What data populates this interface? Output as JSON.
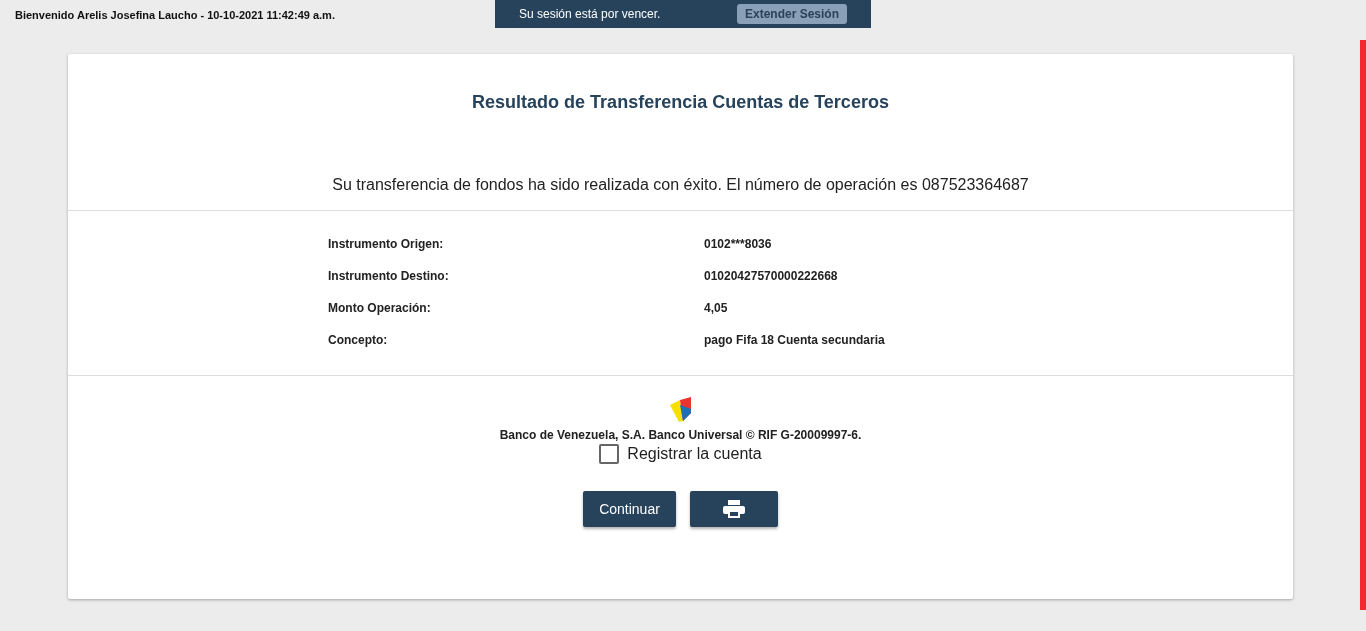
{
  "header": {
    "welcome": "Bienvenido Arelis Josefina Laucho - 10-10-2021 11:42:49 a.m."
  },
  "session_toast": {
    "message": "Su sesión está por vencer.",
    "button": "Extender Sesión"
  },
  "title": "Resultado de Transferencia Cuentas de Terceros",
  "message": "Su transferencia de fondos ha sido realizada con éxito. El número de operación es 087523364687",
  "details": [
    {
      "label": "Instrumento Origen:",
      "value": "0102***8036"
    },
    {
      "label": "Instrumento Destino:",
      "value": "01020427570000222668"
    },
    {
      "label": "Monto Operación:",
      "value": "4,05"
    },
    {
      "label": "Concepto:",
      "value": "pago Fifa 18 Cuenta secundaria"
    }
  ],
  "footer": {
    "legal": "Banco de Venezuela, S.A. Banco Universal © RIF G-20009997-6."
  },
  "register_checkbox": {
    "label": "Registrar la cuenta",
    "checked": false
  },
  "buttons": [
    {
      "kind": "text",
      "label": "Continuar"
    },
    {
      "kind": "print"
    }
  ]
}
